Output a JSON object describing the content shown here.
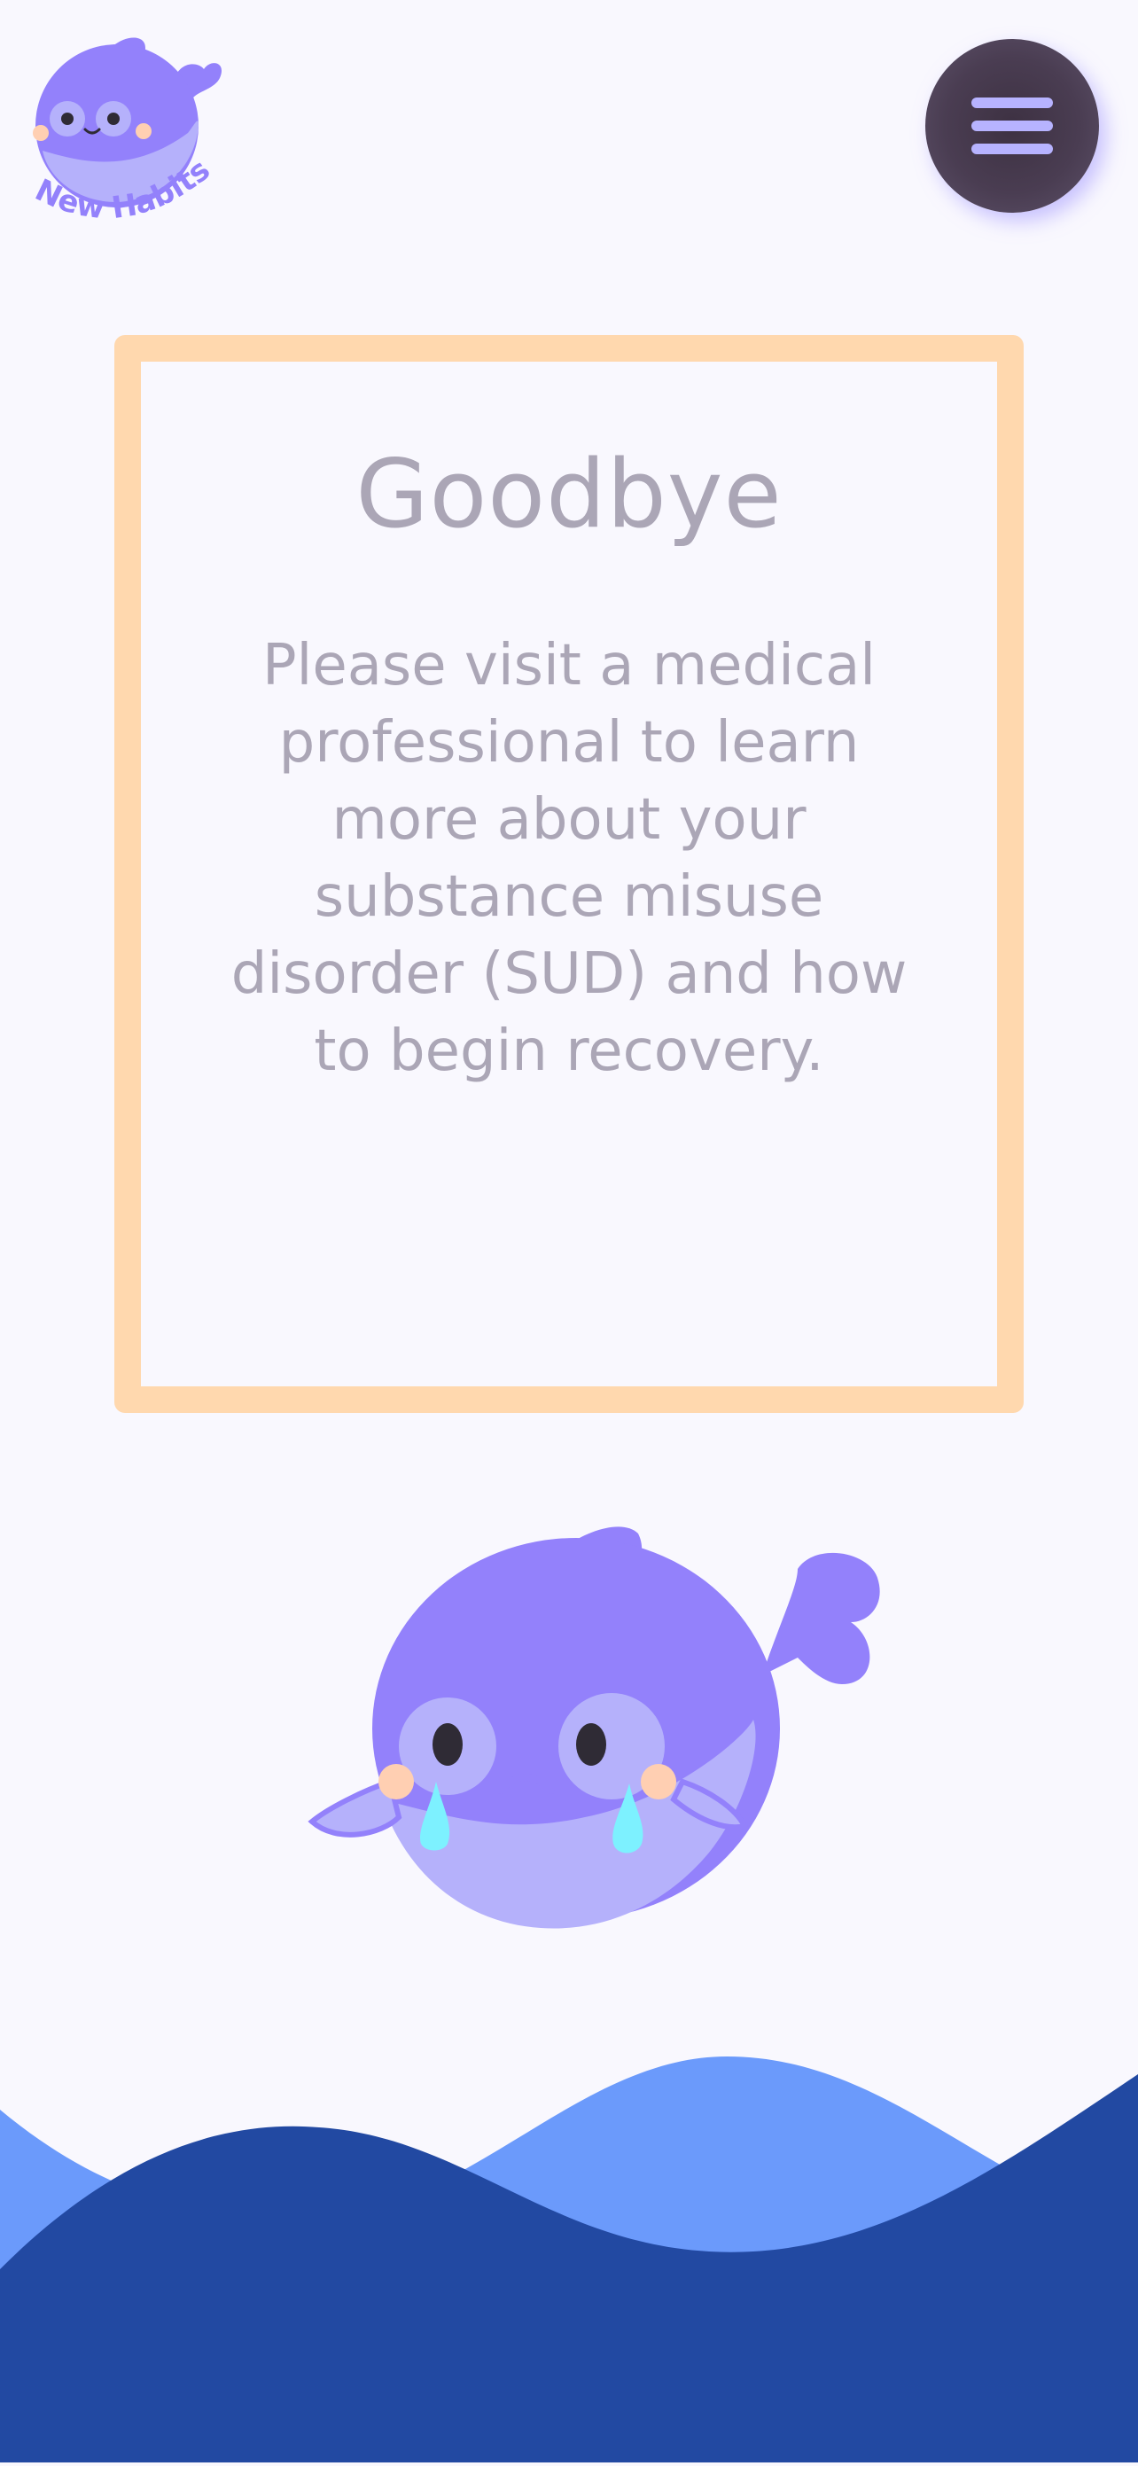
{
  "brand": {
    "logo_text": "New Habits",
    "logo_icon": "whale-logo"
  },
  "header": {
    "menu_icon": "hamburger-menu-icon"
  },
  "card": {
    "title": "Goodbye",
    "message": "Please visit a medical professional to learn more about your substance misuse disorder (SUD) and how to begin recovery."
  },
  "illustration": {
    "icon": "crying-whale-icon"
  },
  "colors": {
    "background": "#f9f8fe",
    "card_border": "#ffd8ae",
    "text": "#aba6b6",
    "whale_body": "#9381fb",
    "whale_belly": "#b5b1fb",
    "wave_light": "#6b9afb",
    "wave_dark": "#2249a2",
    "menu_button": "#4a3d52",
    "menu_lines": "#b7b3ff"
  }
}
